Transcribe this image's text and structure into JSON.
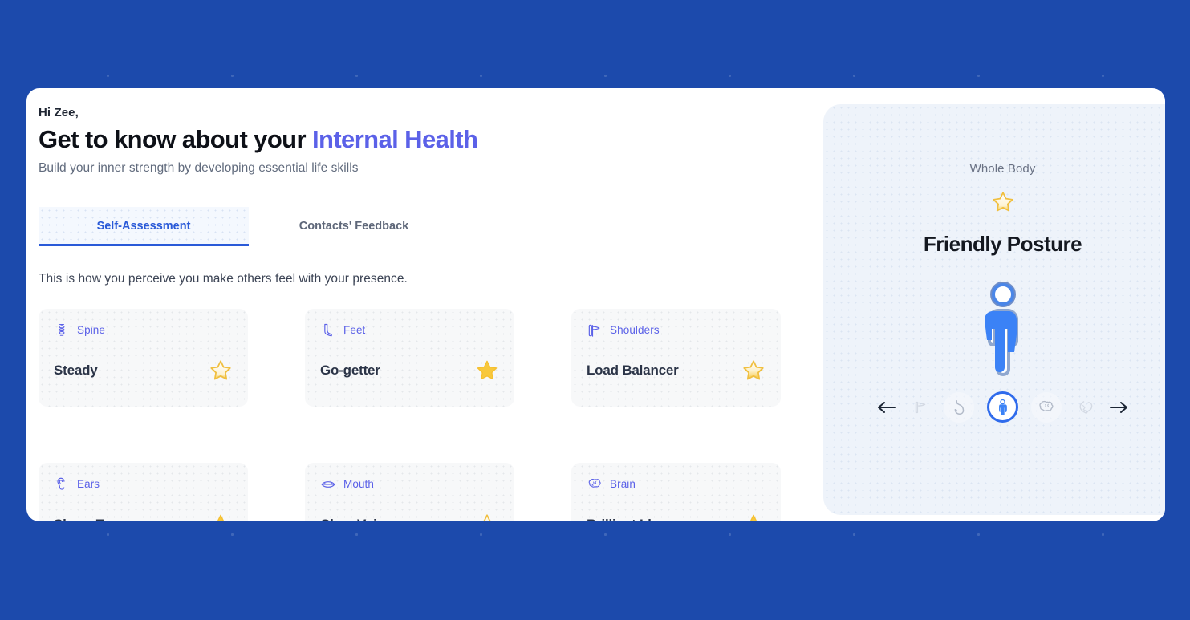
{
  "theme": {
    "page_bg": "#1c4aac",
    "accent_indigo": "#5b61e8",
    "accent_blue": "#2a5ad8",
    "star_gold": "#f7c53f",
    "card_bg": "#f7f8f9",
    "panel_bg": "#eef3fa"
  },
  "header": {
    "greeting": "Hi Zee,",
    "title_plain": "Get to know about your ",
    "title_accent": "Internal Health",
    "subtitle": "Build your inner strength by developing essential life skills"
  },
  "tabs": [
    {
      "label": "Self-Assessment",
      "active": true
    },
    {
      "label": "Contacts' Feedback",
      "active": false
    }
  ],
  "section": {
    "description": "This is how you perceive you make others feel with your presence."
  },
  "cards": [
    {
      "part": "Spine",
      "icon": "spine-icon",
      "title": "Steady",
      "star": "outline"
    },
    {
      "part": "Feet",
      "icon": "feet-icon",
      "title": "Go-getter",
      "star": "filled"
    },
    {
      "part": "Shoulders",
      "icon": "shoulders-icon",
      "title": "Load Balancer",
      "star": "partial"
    },
    {
      "part": "Ears",
      "icon": "ear-icon",
      "title": "Sharp Ears",
      "star": "filled"
    },
    {
      "part": "Mouth",
      "icon": "mouth-icon",
      "title": "Clear Voice",
      "star": "partial"
    },
    {
      "part": "Brain",
      "icon": "brain-icon",
      "title": "Brilliant Ideas",
      "star": "filled"
    }
  ],
  "detail_panel": {
    "label": "Whole Body",
    "star": "outline",
    "title": "Friendly Posture",
    "figure": "body-figure"
  },
  "carousel": {
    "prev_icon": "arrow-left-icon",
    "next_icon": "arrow-right-icon",
    "items": [
      {
        "icon": "shoulders-icon",
        "state": "edge",
        "label": "Shoulders"
      },
      {
        "icon": "stomach-icon",
        "state": "soft",
        "label": "Stomach"
      },
      {
        "icon": "body-icon",
        "state": "active",
        "label": "Whole Body"
      },
      {
        "icon": "brain-icon",
        "state": "soft",
        "label": "Brain"
      },
      {
        "icon": "heart-icon",
        "state": "edge",
        "label": "Heart"
      }
    ]
  }
}
